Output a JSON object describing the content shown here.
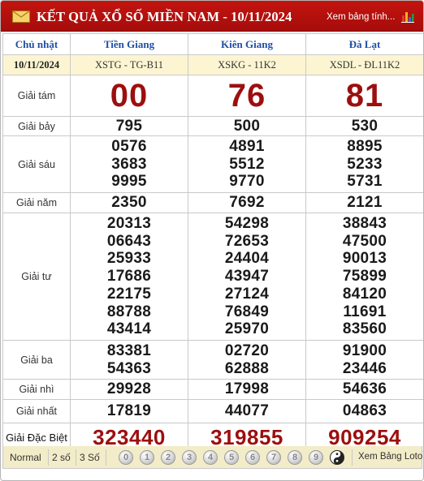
{
  "header": {
    "title": "KẾT QUẢ XỔ SỐ MIỀN NAM - 10/11/2024",
    "link": "Xem bảng tính...",
    "bg_color": "#b8110d"
  },
  "table": {
    "day": "Chủ nhật",
    "date": "10/11/2024",
    "provinces": [
      {
        "name": "Tiền Giang",
        "code": "XSTG - TG-B11"
      },
      {
        "name": "Kiên Giang",
        "code": "XSKG - 11K2"
      },
      {
        "name": "Đà Lạt",
        "code": "XSDL - ĐL11K2"
      }
    ],
    "prizes": {
      "g8": {
        "label": "Giải tám",
        "values": [
          "00",
          "76",
          "81"
        ]
      },
      "g7": {
        "label": "Giải bảy",
        "values": [
          "795",
          "500",
          "530"
        ]
      },
      "g6": {
        "label": "Giải sáu",
        "values": [
          [
            "0576",
            "3683",
            "9995"
          ],
          [
            "4891",
            "5512",
            "9770"
          ],
          [
            "8895",
            "5233",
            "5731"
          ]
        ]
      },
      "g5": {
        "label": "Giải năm",
        "values": [
          "2350",
          "7692",
          "2121"
        ]
      },
      "g4": {
        "label": "Giải tư",
        "values": [
          [
            "20313",
            "06643",
            "25933",
            "17686",
            "22175",
            "88788",
            "43414"
          ],
          [
            "54298",
            "72653",
            "24404",
            "43947",
            "27124",
            "76849",
            "25970"
          ],
          [
            "38843",
            "47500",
            "90013",
            "75899",
            "84120",
            "11691",
            "83560"
          ]
        ]
      },
      "g3": {
        "label": "Giải ba",
        "values": [
          [
            "83381",
            "54363"
          ],
          [
            "02720",
            "62888"
          ],
          [
            "91900",
            "23446"
          ]
        ]
      },
      "g2": {
        "label": "Giải nhì",
        "values": [
          "29928",
          "17998",
          "54636"
        ]
      },
      "g1": {
        "label": "Giải nhất",
        "values": [
          "17819",
          "44077",
          "04863"
        ]
      },
      "db": {
        "label": "Giải Đặc Biệt",
        "values": [
          "323440",
          "319855",
          "909254"
        ]
      }
    }
  },
  "footer": {
    "options": [
      "Normal",
      "2 số",
      "3 Số"
    ],
    "digits": [
      "0",
      "1",
      "2",
      "3",
      "4",
      "5",
      "6",
      "7",
      "8",
      "9"
    ],
    "loto_link": "Xem Bảng Loto"
  }
}
